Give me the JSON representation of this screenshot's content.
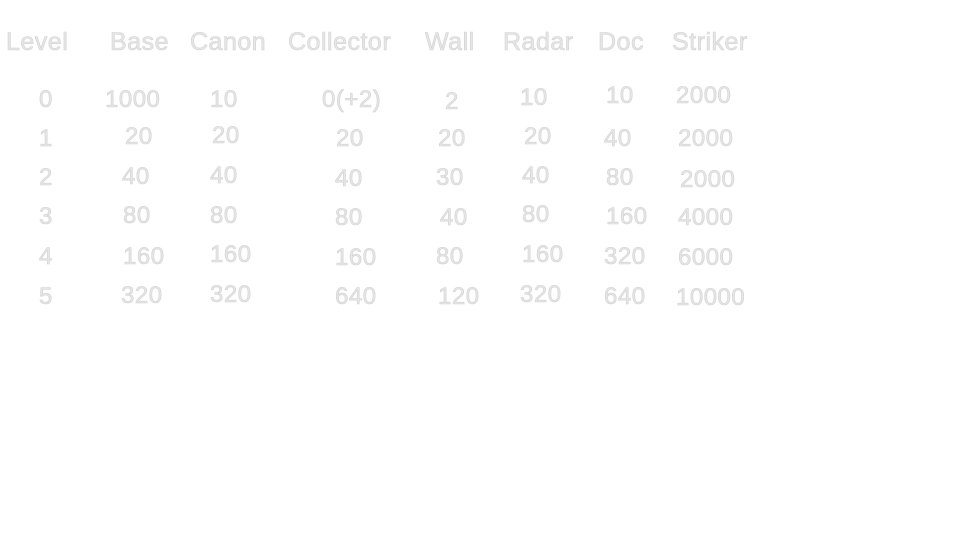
{
  "headers": {
    "level": "Level",
    "base": "Base",
    "canon": "Canon",
    "collector": "Collector",
    "wall": "Wall",
    "radar": "Radar",
    "doc": "Doc",
    "striker": "Striker"
  },
  "rows": [
    {
      "level": "0",
      "base": "1000",
      "canon": "10",
      "collector": "0(+2)",
      "wall": "2",
      "radar": "10",
      "doc": "10",
      "striker": "2000"
    },
    {
      "level": "1",
      "base": "20",
      "canon": "20",
      "collector": "20",
      "wall": "20",
      "radar": "20",
      "doc": "40",
      "striker": "2000"
    },
    {
      "level": "2",
      "base": "40",
      "canon": "40",
      "collector": "40",
      "wall": "30",
      "radar": "40",
      "doc": "80",
      "striker": "2000"
    },
    {
      "level": "3",
      "base": "80",
      "canon": "80",
      "collector": "80",
      "wall": "40",
      "radar": "80",
      "doc": "160",
      "striker": "4000"
    },
    {
      "level": "4",
      "base": "160",
      "canon": "160",
      "collector": "160",
      "wall": "80",
      "radar": "160",
      "doc": "320",
      "striker": "6000"
    },
    {
      "level": "5",
      "base": "320",
      "canon": "320",
      "collector": "640",
      "wall": "120",
      "radar": "320",
      "doc": "640",
      "striker": "10000"
    }
  ]
}
